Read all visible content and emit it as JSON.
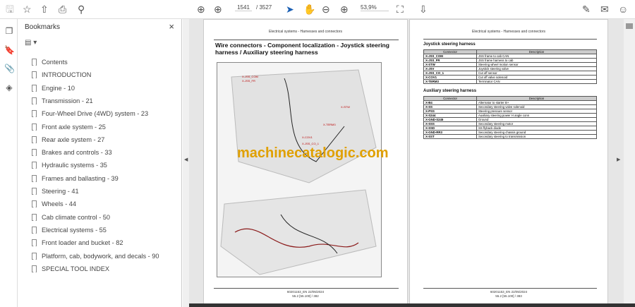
{
  "toolbar": {
    "page_current": "1541",
    "page_total": "/ 3527",
    "zoom": "53,9%",
    "icons": [
      "save-icon",
      "bookmark-star-icon",
      "upload-icon",
      "print-icon",
      "search-icon",
      "prev-page-icon",
      "next-page-icon",
      "select-cursor-icon",
      "hand-icon",
      "zoom-out-icon",
      "zoom-in-icon",
      "fit-page-icon",
      "read-mode-icon",
      "sign-icon",
      "email-icon",
      "account-icon"
    ]
  },
  "bookmarks": {
    "title": "Bookmarks",
    "close": "×",
    "options": "▤ ▾",
    "items": [
      "Contents",
      "INTRODUCTION",
      "Engine - 10",
      "Transmission - 21",
      "Four-Wheel Drive (4WD) system - 23",
      "Front axle system - 25",
      "Rear axle system - 27",
      "Brakes and controls - 33",
      "Hydraulic systems - 35",
      "Frames and ballasting - 39",
      "Steering - 41",
      "Wheels - 44",
      "Cab climate control - 50",
      "Electrical systems - 55",
      "Front loader and bucket - 82",
      "Platform, cab, bodywork, and decals - 90",
      "SPECIAL TOOL INDEX"
    ]
  },
  "left_page": {
    "header": "Electrical systems - Harnesses and connectors",
    "title": "Wire connectors - Component localization - Joystick steering harness / Auxiliary steering harness",
    "fig_labels": [
      "X-JSS_COM",
      "X-JSS_FR",
      "X-STW",
      "X-TERM3",
      "X-COV1",
      "X-JSS_CO_1"
    ],
    "footer1": "60201153_EN 22/05/2024",
    "footer2": "55.2 [55.100] / 382"
  },
  "right_page": {
    "header": "Electrical systems - Harnesses and connectors",
    "joystick_title": "Joystick steering harness",
    "aux_title": "Auxiliary steering harness",
    "col_connector": "Connector",
    "col_description": "Description",
    "joystick_rows": [
      [
        "X-JSS_COM",
        "JSS frame to cab CAN"
      ],
      [
        "X-JSS_FR",
        "JSS frame harness to cab"
      ],
      [
        "X-STW",
        "Steering wheel motion sensor"
      ],
      [
        "X-JSV",
        "Joystick steering valve"
      ],
      [
        "X-JSS_CO_1",
        "Cut off sensor"
      ],
      [
        "X-COV1",
        "Cut off valve solenoid"
      ],
      [
        "X-TERM3",
        "Terminator CAN"
      ]
    ],
    "aux_rows": [
      [
        "X-B4",
        "Alternator to starter B+"
      ],
      [
        "X-SS",
        "Secondary steering valve solenoid"
      ],
      [
        "X-PSS",
        "Steering pressure sensor"
      ],
      [
        "X-S244",
        "Auxiliary steering power H angle conn"
      ],
      [
        "X-GND-S245",
        "Ground"
      ],
      [
        "X-SSS",
        "Secondary steering motor"
      ],
      [
        "X-SSD",
        "SS flyback diode"
      ],
      [
        "X-GND-RR3",
        "Secondary steering chassis ground"
      ],
      [
        "X-SST",
        "Secondary steering to transmission"
      ]
    ],
    "footer1": "60201153_EN 22/05/2024",
    "footer2": "55.2 [55.100] / 383"
  },
  "watermark": "machinecatalogic.com"
}
